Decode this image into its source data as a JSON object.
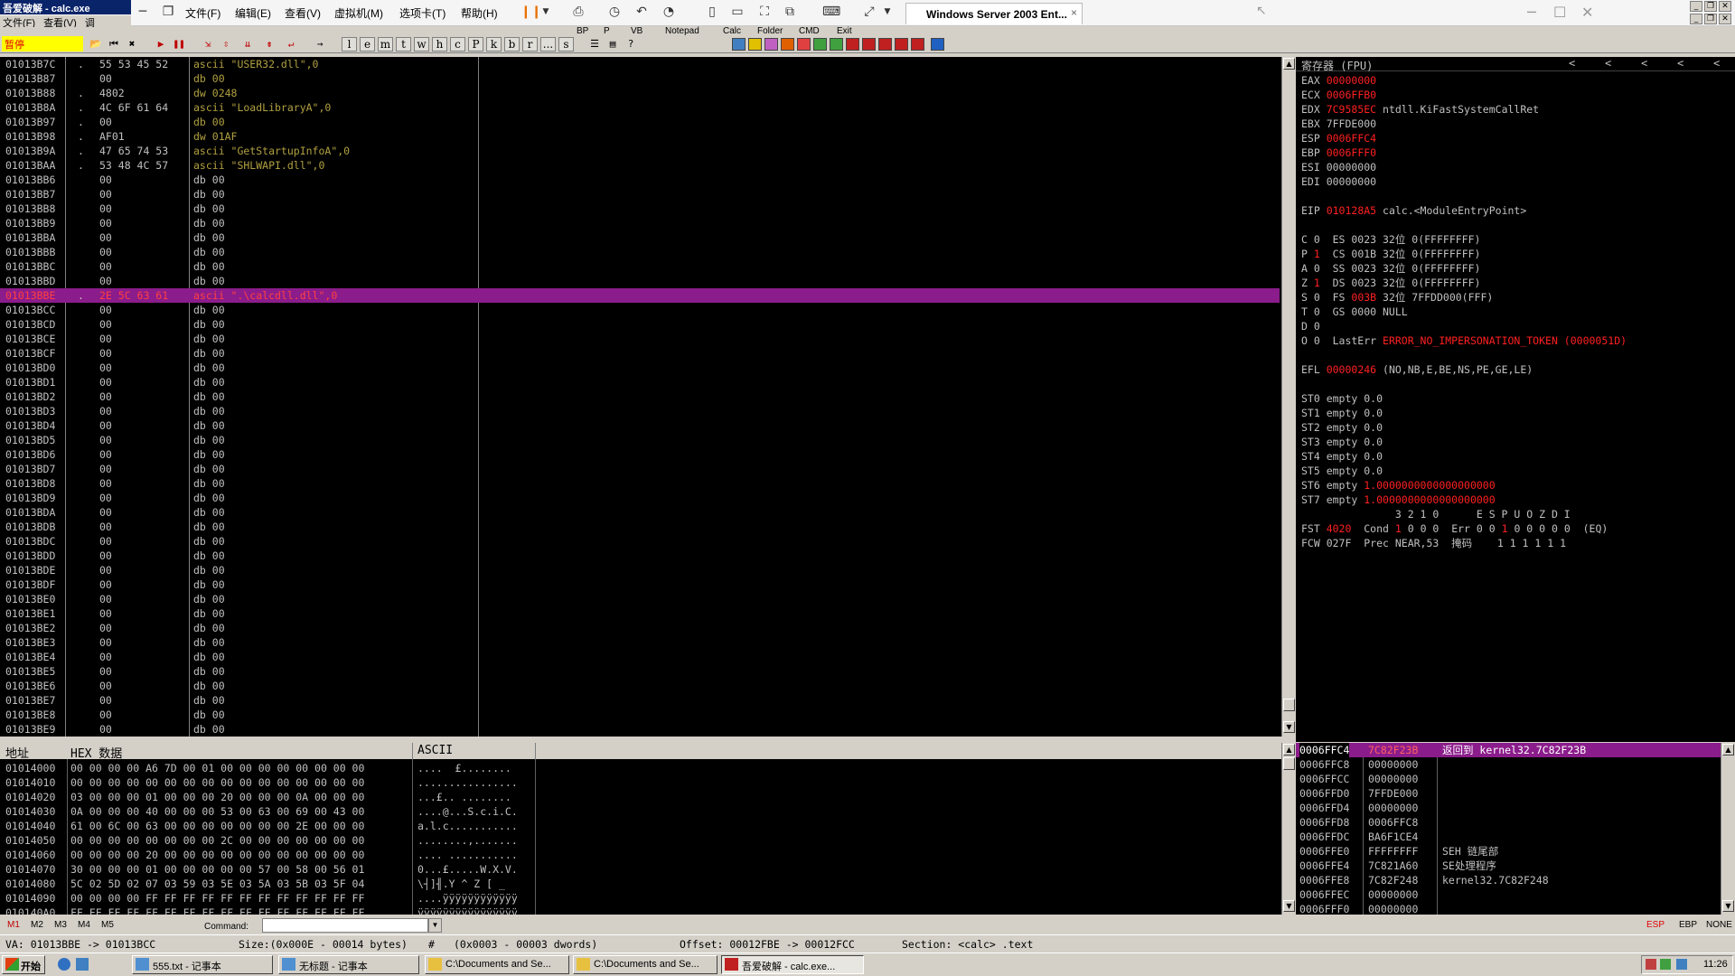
{
  "app": {
    "title": "吾爱破解 - calc.exe",
    "menu": [
      "文件(F)",
      "查看(V)",
      "调"
    ]
  },
  "vm": {
    "menu": [
      "文件(F)",
      "编辑(E)",
      "查看(V)",
      "虚拟机(M)",
      "选项卡(T)",
      "帮助(H)"
    ],
    "tab": "Windows Server 2003 Ent...",
    "tab_close": "×"
  },
  "toolbar": {
    "status": "暂停",
    "letters": [
      "l",
      "e",
      "m",
      "t",
      "w",
      "h",
      "c",
      "P",
      "k",
      "b",
      "r",
      "...",
      "s"
    ],
    "plugins": [
      "BP",
      "P",
      "VB",
      "Notepad",
      "Calc",
      "Folder",
      "CMD",
      "Exit"
    ]
  },
  "disasm": [
    {
      "addr": "01013B7C",
      "mark": ".",
      "hex": "55 53 45 52",
      "text": "ascii \"USER32.dll\",0",
      "style": "olive"
    },
    {
      "addr": "01013B87",
      "mark": "",
      "hex": "00",
      "text": "db 00",
      "style": "olive"
    },
    {
      "addr": "01013B88",
      "mark": ".",
      "hex": "4802",
      "text": "dw 0248",
      "style": "olive"
    },
    {
      "addr": "01013B8A",
      "mark": ".",
      "hex": "4C 6F 61 64",
      "text": "ascii \"LoadLibraryA\",0",
      "style": "olive"
    },
    {
      "addr": "01013B97",
      "mark": ".",
      "hex": "00",
      "text": "db 00",
      "style": "olive"
    },
    {
      "addr": "01013B98",
      "mark": ".",
      "hex": "AF01",
      "text": "dw 01AF",
      "style": "olive"
    },
    {
      "addr": "01013B9A",
      "mark": ".",
      "hex": "47 65 74 53",
      "text": "ascii \"GetStartupInfoA\",0",
      "style": "olive"
    },
    {
      "addr": "01013BAA",
      "mark": ".",
      "hex": "53 48 4C 57",
      "text": "ascii \"SHLWAPI.dll\",0",
      "style": "olive"
    },
    {
      "addr": "01013BB6",
      "mark": "",
      "hex": "00",
      "text": "db 00",
      "style": "dim"
    },
    {
      "addr": "01013BB7",
      "mark": "",
      "hex": "00",
      "text": "db 00",
      "style": "dim"
    },
    {
      "addr": "01013BB8",
      "mark": "",
      "hex": "00",
      "text": "db 00",
      "style": "dim"
    },
    {
      "addr": "01013BB9",
      "mark": "",
      "hex": "00",
      "text": "db 00",
      "style": "dim"
    },
    {
      "addr": "01013BBA",
      "mark": "",
      "hex": "00",
      "text": "db 00",
      "style": "dim"
    },
    {
      "addr": "01013BBB",
      "mark": "",
      "hex": "00",
      "text": "db 00",
      "style": "dim"
    },
    {
      "addr": "01013BBC",
      "mark": "",
      "hex": "00",
      "text": "db 00",
      "style": "dim"
    },
    {
      "addr": "01013BBD",
      "mark": "",
      "hex": "00",
      "text": "db 00",
      "style": "dim"
    },
    {
      "addr": "01013BBE",
      "mark": ".",
      "hex": "2E 5C 63 61",
      "text": "ascii \".\\calcdll.dll\",0",
      "style": "sel"
    },
    {
      "addr": "01013BCC",
      "mark": "",
      "hex": "00",
      "text": "db 00",
      "style": "dim"
    },
    {
      "addr": "01013BCD",
      "mark": "",
      "hex": "00",
      "text": "db 00",
      "style": "dim"
    },
    {
      "addr": "01013BCE",
      "mark": "",
      "hex": "00",
      "text": "db 00",
      "style": "dim"
    },
    {
      "addr": "01013BCF",
      "mark": "",
      "hex": "00",
      "text": "db 00",
      "style": "dim"
    },
    {
      "addr": "01013BD0",
      "mark": "",
      "hex": "00",
      "text": "db 00",
      "style": "dim"
    },
    {
      "addr": "01013BD1",
      "mark": "",
      "hex": "00",
      "text": "db 00",
      "style": "dim"
    },
    {
      "addr": "01013BD2",
      "mark": "",
      "hex": "00",
      "text": "db 00",
      "style": "dim"
    },
    {
      "addr": "01013BD3",
      "mark": "",
      "hex": "00",
      "text": "db 00",
      "style": "dim"
    },
    {
      "addr": "01013BD4",
      "mark": "",
      "hex": "00",
      "text": "db 00",
      "style": "dim"
    },
    {
      "addr": "01013BD5",
      "mark": "",
      "hex": "00",
      "text": "db 00",
      "style": "dim"
    },
    {
      "addr": "01013BD6",
      "mark": "",
      "hex": "00",
      "text": "db 00",
      "style": "dim"
    },
    {
      "addr": "01013BD7",
      "mark": "",
      "hex": "00",
      "text": "db 00",
      "style": "dim"
    },
    {
      "addr": "01013BD8",
      "mark": "",
      "hex": "00",
      "text": "db 00",
      "style": "dim"
    },
    {
      "addr": "01013BD9",
      "mark": "",
      "hex": "00",
      "text": "db 00",
      "style": "dim"
    },
    {
      "addr": "01013BDA",
      "mark": "",
      "hex": "00",
      "text": "db 00",
      "style": "dim"
    },
    {
      "addr": "01013BDB",
      "mark": "",
      "hex": "00",
      "text": "db 00",
      "style": "dim"
    },
    {
      "addr": "01013BDC",
      "mark": "",
      "hex": "00",
      "text": "db 00",
      "style": "dim"
    },
    {
      "addr": "01013BDD",
      "mark": "",
      "hex": "00",
      "text": "db 00",
      "style": "dim"
    },
    {
      "addr": "01013BDE",
      "mark": "",
      "hex": "00",
      "text": "db 00",
      "style": "dim"
    },
    {
      "addr": "01013BDF",
      "mark": "",
      "hex": "00",
      "text": "db 00",
      "style": "dim"
    },
    {
      "addr": "01013BE0",
      "mark": "",
      "hex": "00",
      "text": "db 00",
      "style": "dim"
    },
    {
      "addr": "01013BE1",
      "mark": "",
      "hex": "00",
      "text": "db 00",
      "style": "dim"
    },
    {
      "addr": "01013BE2",
      "mark": "",
      "hex": "00",
      "text": "db 00",
      "style": "dim"
    },
    {
      "addr": "01013BE3",
      "mark": "",
      "hex": "00",
      "text": "db 00",
      "style": "dim"
    },
    {
      "addr": "01013BE4",
      "mark": "",
      "hex": "00",
      "text": "db 00",
      "style": "dim"
    },
    {
      "addr": "01013BE5",
      "mark": "",
      "hex": "00",
      "text": "db 00",
      "style": "dim"
    },
    {
      "addr": "01013BE6",
      "mark": "",
      "hex": "00",
      "text": "db 00",
      "style": "dim"
    },
    {
      "addr": "01013BE7",
      "mark": "",
      "hex": "00",
      "text": "db 00",
      "style": "dim"
    },
    {
      "addr": "01013BE8",
      "mark": "",
      "hex": "00",
      "text": "db 00",
      "style": "dim"
    },
    {
      "addr": "01013BE9",
      "mark": "",
      "hex": "00",
      "text": "db 00",
      "style": "dim"
    }
  ],
  "registers": {
    "header": "寄存器 (FPU)",
    "header_arrows": [
      "<",
      "<",
      "<",
      "<",
      "<"
    ],
    "lines": [
      [
        {
          "t": "EAX "
        },
        {
          "t": "00000000",
          "c": "red"
        }
      ],
      [
        {
          "t": "ECX "
        },
        {
          "t": "0006FFB0",
          "c": "red"
        }
      ],
      [
        {
          "t": "EDX "
        },
        {
          "t": "7C9585EC",
          "c": "red"
        },
        {
          "t": " ntdll.KiFastSystemCallRet"
        }
      ],
      [
        {
          "t": "EBX 7FFDE000"
        }
      ],
      [
        {
          "t": "ESP "
        },
        {
          "t": "0006FFC4",
          "c": "red"
        }
      ],
      [
        {
          "t": "EBP "
        },
        {
          "t": "0006FFF0",
          "c": "red"
        }
      ],
      [
        {
          "t": "ESI 00000000"
        }
      ],
      [
        {
          "t": "EDI 00000000"
        }
      ],
      [
        {
          "t": ""
        }
      ],
      [
        {
          "t": "EIP "
        },
        {
          "t": "010128A5",
          "c": "red"
        },
        {
          "t": " calc.<ModuleEntryPoint>"
        }
      ],
      [
        {
          "t": ""
        }
      ],
      [
        {
          "t": "C 0  ES 0023 32位 0(FFFFFFFF)"
        }
      ],
      [
        {
          "t": "P "
        },
        {
          "t": "1",
          "c": "red"
        },
        {
          "t": "  CS 001B 32位 0(FFFFFFFF)"
        }
      ],
      [
        {
          "t": "A 0  SS 0023 32位 0(FFFFFFFF)"
        }
      ],
      [
        {
          "t": "Z "
        },
        {
          "t": "1",
          "c": "red"
        },
        {
          "t": "  DS 0023 32位 0(FFFFFFFF)"
        }
      ],
      [
        {
          "t": "S 0  FS "
        },
        {
          "t": "003B",
          "c": "red"
        },
        {
          "t": " 32位 7FFDD000(FFF)"
        }
      ],
      [
        {
          "t": "T 0  GS 0000 NULL"
        }
      ],
      [
        {
          "t": "D 0"
        }
      ],
      [
        {
          "t": "O 0  LastErr "
        },
        {
          "t": "ERROR_NO_IMPERSONATION_TOKEN (0000051D)",
          "c": "red"
        }
      ],
      [
        {
          "t": ""
        }
      ],
      [
        {
          "t": "EFL "
        },
        {
          "t": "00000246",
          "c": "red"
        },
        {
          "t": " (NO,NB,E,BE,NS,PE,GE,LE)"
        }
      ],
      [
        {
          "t": ""
        }
      ],
      [
        {
          "t": "ST0 empty 0.0"
        }
      ],
      [
        {
          "t": "ST1 empty 0.0"
        }
      ],
      [
        {
          "t": "ST2 empty 0.0"
        }
      ],
      [
        {
          "t": "ST3 empty 0.0"
        }
      ],
      [
        {
          "t": "ST4 empty 0.0"
        }
      ],
      [
        {
          "t": "ST5 empty 0.0"
        }
      ],
      [
        {
          "t": "ST6 empty "
        },
        {
          "t": "1.0000000000000000000",
          "c": "red"
        }
      ],
      [
        {
          "t": "ST7 empty "
        },
        {
          "t": "1.0000000000000000000",
          "c": "red"
        }
      ],
      [
        {
          "t": "               3 2 1 0      E S P U O Z D I"
        }
      ],
      [
        {
          "t": "FST "
        },
        {
          "t": "4020",
          "c": "red"
        },
        {
          "t": "  Cond "
        },
        {
          "t": "1",
          "c": "red"
        },
        {
          "t": " 0 0 0  Err 0 0 "
        },
        {
          "t": "1",
          "c": "red"
        },
        {
          "t": " 0 0 0 0 0  (EQ)"
        }
      ],
      [
        {
          "t": "FCW 027F  Prec NEAR,53  掩码    1 1 1 1 1 1"
        }
      ]
    ]
  },
  "dump": {
    "headers": {
      "addr": "地址",
      "hex": "HEX 数据",
      "ascii": "ASCII"
    },
    "rows": [
      {
        "addr": "01014000",
        "hex": "00 00 00 00 A6 7D 00 01 00 00 00 00 00 00 00 00",
        "ascii": "....  £........"
      },
      {
        "addr": "01014010",
        "hex": "00 00 00 00 00 00 00 00 00 00 00 00 00 00 00 00",
        "ascii": "................"
      },
      {
        "addr": "01014020",
        "hex": "03 00 00 00 01 00 00 00 20 00 00 00 0A 00 00 00",
        "ascii": "...£.. ........"
      },
      {
        "addr": "01014030",
        "hex": "0A 00 00 00 40 00 00 00 53 00 63 00 69 00 43 00",
        "ascii": "....@...S.c.i.C."
      },
      {
        "addr": "01014040",
        "hex": "61 00 6C 00 63 00 00 00 00 00 00 00 2E 00 00 00",
        "ascii": "a.l.c..........."
      },
      {
        "addr": "01014050",
        "hex": "00 00 00 00 00 00 00 00 2C 00 00 00 00 00 00 00",
        "ascii": "........,......."
      },
      {
        "addr": "01014060",
        "hex": "00 00 00 00 20 00 00 00 00 00 00 00 00 00 00 00",
        "ascii": ".... ..........."
      },
      {
        "addr": "01014070",
        "hex": "30 00 00 00 01 00 00 00 00 00 57 00 58 00 56 01",
        "ascii": "0...£.....W.X.V."
      },
      {
        "addr": "01014080",
        "hex": "5C 02 5D 02 07 03 59 03 5E 03 5A 03 5B 03 5F 04",
        "ascii": "\\┤]╢.Y ^ Z [ _ "
      },
      {
        "addr": "01014090",
        "hex": "00 00 00 00 FF FF FF FF FF FF FF FF FF FF FF FF",
        "ascii": "....ÿÿÿÿÿÿÿÿÿÿÿÿ"
      },
      {
        "addr": "010140A0",
        "hex": "FF FF FF FF FF FF FF FF FF FF FF FF FF FF FF FF",
        "ascii": "ÿÿÿÿÿÿÿÿÿÿÿÿÿÿÿÿ"
      }
    ]
  },
  "stack": [
    {
      "addr": "0006FFC4",
      "val": "7C82F23B",
      "cmt": "返回到 kernel32.7C82F23B",
      "sel": true
    },
    {
      "addr": "0006FFC8",
      "val": "00000000",
      "cmt": ""
    },
    {
      "addr": "0006FFCC",
      "val": "00000000",
      "cmt": ""
    },
    {
      "addr": "0006FFD0",
      "val": "7FFDE000",
      "cmt": ""
    },
    {
      "addr": "0006FFD4",
      "val": "00000000",
      "cmt": ""
    },
    {
      "addr": "0006FFD8",
      "val": "0006FFC8",
      "cmt": ""
    },
    {
      "addr": "0006FFDC",
      "val": "BA6F1CE4",
      "cmt": ""
    },
    {
      "addr": "0006FFE0",
      "val": "FFFFFFFF",
      "cmt": "SEH 链尾部"
    },
    {
      "addr": "0006FFE4",
      "val": "7C821A60",
      "cmt": "SE处理程序"
    },
    {
      "addr": "0006FFE8",
      "val": "7C82F248",
      "cmt": "kernel32.7C82F248"
    },
    {
      "addr": "0006FFEC",
      "val": "00000000",
      "cmt": ""
    },
    {
      "addr": "0006FFF0",
      "val": "00000000",
      "cmt": ""
    }
  ],
  "commandbar": {
    "tabs": [
      "M1",
      "M2",
      "M3",
      "M4",
      "M5"
    ],
    "label": "Command:",
    "right": [
      "ESP",
      "EBP",
      "NONE"
    ]
  },
  "status": {
    "va": "VA: 01013BBE -> 01013BCC",
    "size": "Size:(0x000E - 00014 bytes)",
    "hash": "#",
    "dwords": "(0x0003 - 00003 dwords)",
    "offset": "Offset: 00012FBE -> 00012FCC",
    "section": "Section: <calc> .text"
  },
  "taskbar": {
    "start": "开始",
    "items": [
      "555.txt - 记事本",
      "无标题 - 记事本",
      "C:\\Documents and Se...",
      "C:\\Documents and Se...",
      "吾爱破解 - calc.exe..."
    ],
    "clock": "11:26"
  },
  "colors": {
    "selection": "#8b1c8b",
    "red": "#ff2020",
    "olive": "#b0a040",
    "pause_bg": "#ffff00"
  }
}
